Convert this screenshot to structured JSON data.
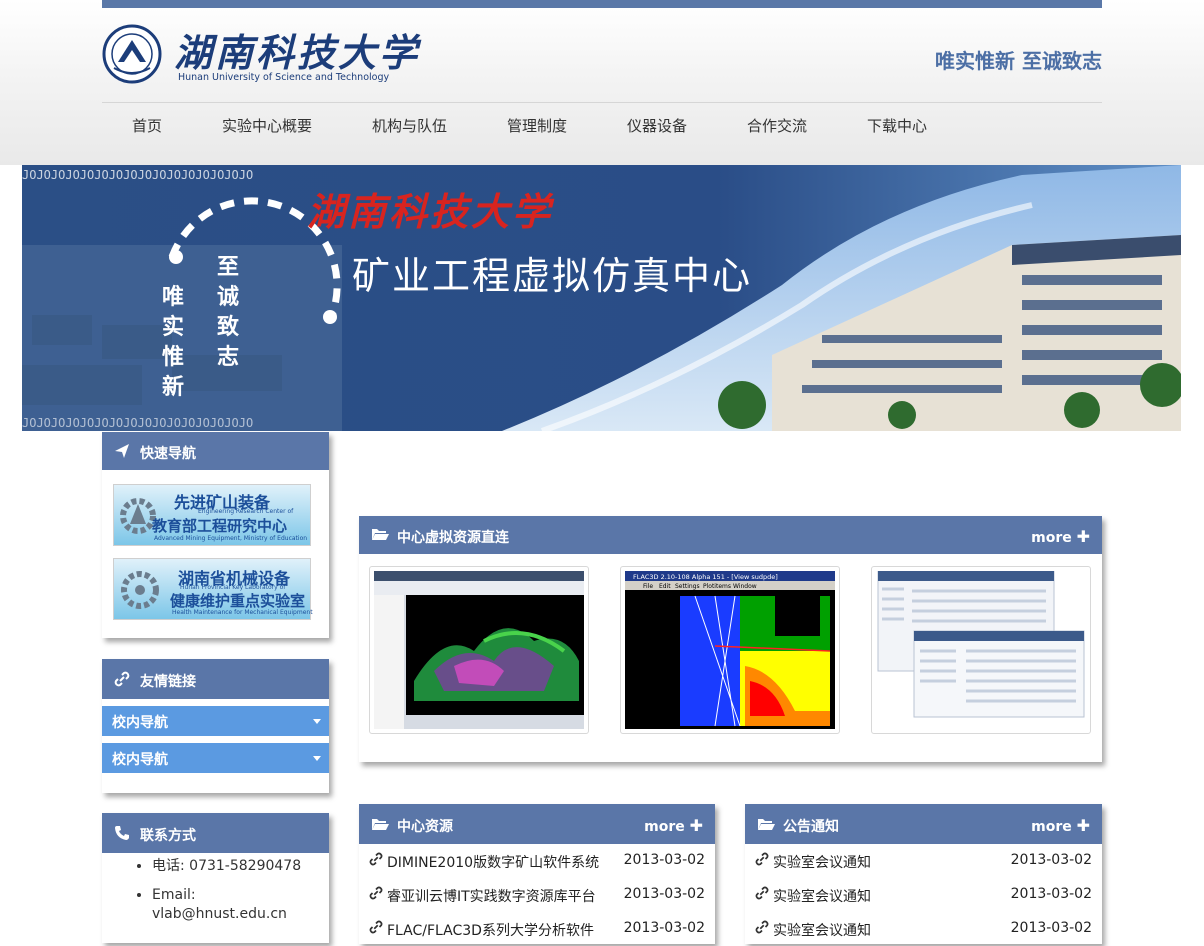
{
  "header": {
    "school_cn": "湖南科技大学",
    "school_en": "Hunan University of Science and Technology",
    "slogan": "唯实惟新 至诚致志"
  },
  "nav": [
    "首页",
    "实验中心概要",
    "机构与队伍",
    "管理制度",
    "仪器设备",
    "合作交流",
    "下载中心"
  ],
  "banner": {
    "school": "湖南科技大学",
    "title": "矿业工程虚拟仿真中心",
    "vertical_1": "至诚致志",
    "vertical_2": "唯实惟新",
    "binary_text": "JOJOJOJOJOJOJOJOJOJOJOJOJOJOJOJO"
  },
  "quick_nav": {
    "title": "快速导航",
    "items": [
      {
        "line1": "先进矿山装备",
        "line2": "Engineering Research Center of",
        "line3": "教育部工程研究中心",
        "line4": "Advanced Mining Equipment, Ministry of Education"
      },
      {
        "line1": "湖南省机械设备",
        "line2": "Hunan Provincial Key Laboratory of",
        "line3": "健康维护重点实验室",
        "line4": "Health Maintenance for Mechanical Equipment"
      }
    ]
  },
  "links": {
    "title": "友情链接",
    "dropdowns": [
      "校内导航",
      "校内导航"
    ]
  },
  "contact": {
    "title": "联系方式",
    "phone": "电话: 0731-58290478",
    "email_label": "Email:",
    "email": "vlab@hnust.edu.cn"
  },
  "virtual": {
    "title": "中心虚拟资源直连",
    "more": "more",
    "thumb2_title": "FLAC3D 2.10-108 Alpha 151 - [View sudpde]",
    "thumb2_menu": [
      "File",
      "Edit",
      "Settings",
      "Plotitems",
      "Window"
    ]
  },
  "resources": {
    "title": "中心资源",
    "more": "more",
    "items": [
      {
        "text": "DIMINE2010版数字矿山软件系统",
        "date": "2013-03-02"
      },
      {
        "text": "睿亚训云博IT实践数字资源库平台",
        "date": "2013-03-02"
      },
      {
        "text": "FLAC/FLAC3D系列大学分析软件",
        "date": "2013-03-02"
      }
    ]
  },
  "notices": {
    "title": "公告通知",
    "more": "more",
    "items": [
      {
        "text": "实验室会议通知",
        "date": "2013-03-02"
      },
      {
        "text": "实验室会议通知",
        "date": "2013-03-02"
      },
      {
        "text": "实验室会议通知",
        "date": "2013-03-02"
      }
    ]
  },
  "colors": {
    "accent": "#5a76a8",
    "dropdown": "#5b9ae1",
    "banner_red": "#d8241f",
    "logo_blue": "#1c3d7a"
  }
}
